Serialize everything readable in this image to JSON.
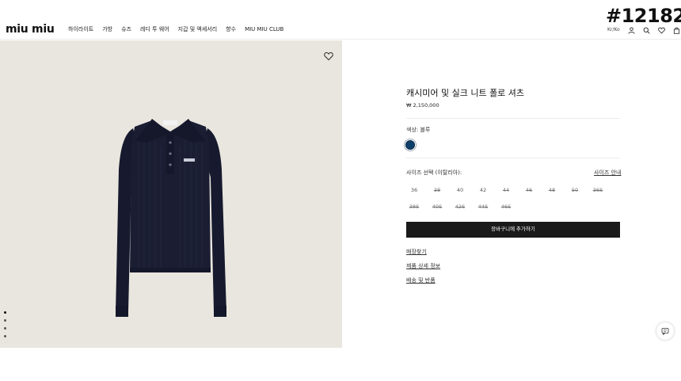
{
  "header": {
    "logo": "miu miu",
    "nav": [
      "하이라이트",
      "가방",
      "슈즈",
      "레디 투 웨어",
      "지갑 및 액세서리",
      "향수",
      "MIU MIU CLUB"
    ],
    "watermark": "#12182",
    "lang": "Kr/Ko",
    "icons": [
      "user-icon",
      "search-icon",
      "heart-icon",
      "bag-icon"
    ]
  },
  "product": {
    "title": "캐시미어 및 실크 니트 폴로 셔츠",
    "price": "₩ 2,150,000",
    "color_label": "색상: 블루",
    "swatch_color": "#0e3e6a",
    "image_bg": "#e9e6df",
    "size_label": "사이즈 선택 (이탈리아):",
    "size_guide": "사이즈 안내",
    "sizes_row1": [
      {
        "label": "36",
        "available": true
      },
      {
        "label": "38",
        "available": false
      },
      {
        "label": "40",
        "available": true
      },
      {
        "label": "42",
        "available": true
      },
      {
        "label": "44",
        "available": false
      },
      {
        "label": "46",
        "available": false
      },
      {
        "label": "48",
        "available": false
      },
      {
        "label": "50",
        "available": false
      },
      {
        "label": "36S",
        "available": false
      }
    ],
    "sizes_row2": [
      {
        "label": "38S",
        "available": false
      },
      {
        "label": "40S",
        "available": false
      },
      {
        "label": "42S",
        "available": false
      },
      {
        "label": "44S",
        "available": false
      },
      {
        "label": "46S",
        "available": false
      }
    ],
    "add_to_cart": "장바구니에 추가하기",
    "links": [
      "매장찾기",
      "제품 상세 정보",
      "배송 및 반품"
    ]
  },
  "carousel": {
    "dots": 4,
    "active": 0
  }
}
